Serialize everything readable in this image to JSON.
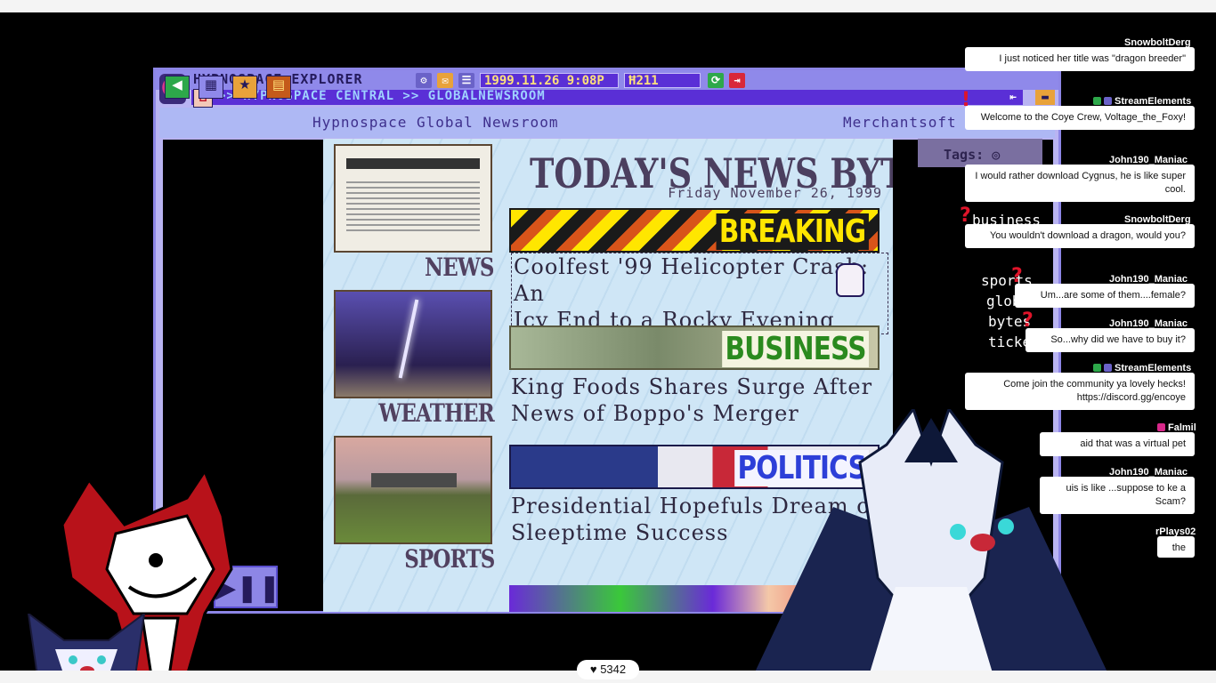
{
  "explorer": {
    "app_title": "HYPNOSPACE EXPLORER",
    "datetime": "1999.11.26   9:08P",
    "hypnocoins": "211",
    "address": ">> HYPNOSPACE CENTRAL >> GLOBALNEWSROOM",
    "page_title": "Hypnospace Global Newsroom",
    "sponsor": "Merchantsoft",
    "tags_label": "Tags:"
  },
  "newsroom": {
    "headline": "TODAY'S NEWS BYTES",
    "date": "Friday November 26, 1999",
    "sections": [
      {
        "label": "NEWS"
      },
      {
        "label": "WEATHER"
      },
      {
        "label": "SPORTS"
      }
    ],
    "banners": [
      {
        "label": "BREAKING",
        "story": [
          "Coolfest '99 Helicopter Crash: An",
          "Icy End to a Rocky Evening"
        ]
      },
      {
        "label": "BUSINESS",
        "story": [
          "King Foods Shares Surge After",
          "News of Boppo's Merger"
        ]
      },
      {
        "label": "POLITICS",
        "story": [
          "Presidential Hopefuls Dream of",
          "Sleeptime Success"
        ]
      }
    ],
    "sidebar_words": [
      "business",
      "sports",
      "global",
      "bytes",
      "ticker"
    ]
  },
  "chat": [
    {
      "user": "SnowboltDerg",
      "text": "I just noticed her title was \"dragon breeder\""
    },
    {
      "user": "StreamElements",
      "text": "Welcome to the Coye Crew, Voltage_the_Foxy!"
    },
    {
      "user": "John190_Maniac",
      "text": "I would rather download Cygnus, he is like super cool."
    },
    {
      "user": "SnowboltDerg",
      "text": "You wouldn't download a dragon, would you?"
    },
    {
      "user": "John190_Maniac",
      "text": "Um...are some of them....female?"
    },
    {
      "user": "John190_Maniac",
      "text": "So...why did we have to buy it?"
    },
    {
      "user": "StreamElements",
      "text": "Come join the community ya lovely hecks! https://discord.gg/encoye"
    },
    {
      "user": "Falmil",
      "text": "aid that was a virtual pet"
    },
    {
      "user": "John190_Maniac",
      "text": "uis is like ...suppose to ke a Scam?"
    },
    {
      "user": "rPlays02",
      "text": "the"
    }
  ],
  "stream": {
    "likes": "5342"
  },
  "colors": {
    "window": "#b9b4f2",
    "address_bar": "#5a2fd6",
    "page_bg": "#cfe6f6",
    "breaking": "#ffe600",
    "business": "#2a8a1e",
    "politics": "#2d3fd8"
  }
}
